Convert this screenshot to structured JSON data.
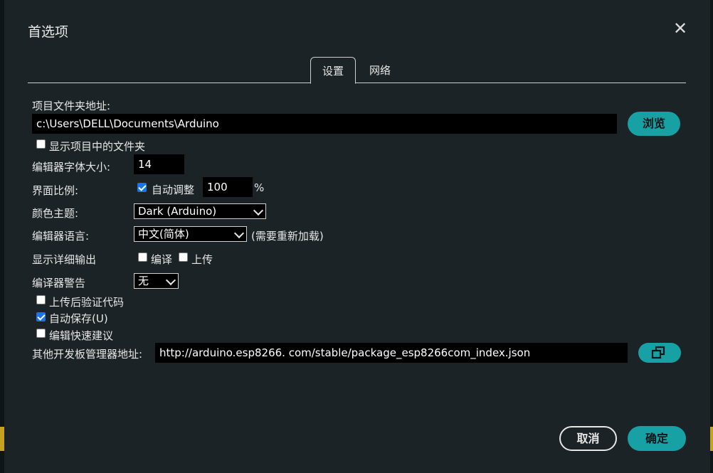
{
  "dialog": {
    "title": "首选项"
  },
  "tabs": [
    {
      "label": "设置",
      "active": true
    },
    {
      "label": "网络",
      "active": false
    }
  ],
  "settings": {
    "sketchbook_label": "项目文件夹地址:",
    "sketchbook_path": "c:\\Users\\DELL\\Documents\\Arduino",
    "browse_label": "浏览",
    "show_files_label": "显示项目中的文件夹",
    "show_files_checked": false,
    "font_size_label": "编辑器字体大小:",
    "font_size_value": "14",
    "scale_label": "界面比例:",
    "auto_scale_label": "自动调整",
    "auto_scale_checked": true,
    "scale_value": "100",
    "scale_unit": "%",
    "theme_label": "颜色主题:",
    "theme_value": "Dark (Arduino)",
    "language_label": "编辑器语言:",
    "language_value": "中文(简体)",
    "language_note": "(需要重新加载)",
    "verbose_label": "显示详细输出",
    "verbose_compile_label": "编译",
    "verbose_compile_checked": false,
    "verbose_upload_label": "上传",
    "verbose_upload_checked": false,
    "warnings_label": "编译器警告",
    "warnings_value": "无",
    "verify_after_upload_label": "上传后验证代码",
    "verify_after_upload_checked": false,
    "autosave_label": "自动保存(U)",
    "autosave_checked": true,
    "quick_suggestions_label": "编辑快速建议",
    "quick_suggestions_checked": false,
    "board_urls_label": "其他开发板管理器地址:",
    "board_urls_value": "http://arduino.esp8266. com/stable/package_esp8266com_index.json"
  },
  "footer": {
    "cancel_label": "取消",
    "ok_label": "确定"
  },
  "colors": {
    "accent": "#17a1a5",
    "background": "#1c2326",
    "input_bg": "#000000",
    "checkbox_checked": "#1a73e8"
  },
  "icons": {
    "close": "close-icon",
    "open_window": "open-window-icon"
  }
}
